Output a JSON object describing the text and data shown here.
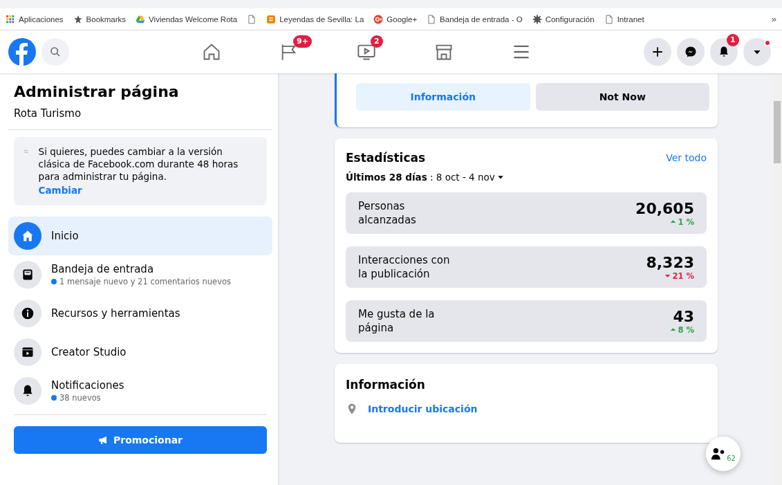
{
  "bookmarks": [
    {
      "label": "Aplicaciones",
      "kind": "apps"
    },
    {
      "label": "Bookmarks",
      "kind": "star"
    },
    {
      "label": "Viviendas Welcome Rota",
      "kind": "drive"
    },
    {
      "kind": "page"
    },
    {
      "label": "Leyendas de Sevilla: La",
      "kind": "blogger"
    },
    {
      "label": "Google+",
      "kind": "gplus"
    },
    {
      "label": "Bandeja de entrada - O",
      "kind": "page"
    },
    {
      "label": "Configuración",
      "kind": "gear"
    },
    {
      "label": "Intranet",
      "kind": "page"
    }
  ],
  "bookmarks_more": "»",
  "nav_tabs": [
    {
      "kind": "home"
    },
    {
      "kind": "flag",
      "badge": "9+"
    },
    {
      "kind": "video",
      "badge": "2"
    },
    {
      "kind": "store"
    },
    {
      "kind": "menu"
    }
  ],
  "nav_actions": [
    {
      "kind": "plus"
    },
    {
      "kind": "messenger"
    },
    {
      "kind": "bell",
      "badge": "1"
    },
    {
      "kind": "caret",
      "dot": true
    }
  ],
  "sidebar": {
    "title": "Administrar página",
    "subtitle": "Rota Turismo",
    "notice": {
      "text": "Si quieres, puedes cambiar a la versión clásica de Facebook.com durante 48 horas para administrar tu página.",
      "link": "Cambiar"
    },
    "items": [
      {
        "kind": "home",
        "label": "Inicio",
        "selected": true
      },
      {
        "kind": "inbox",
        "label": "Bandeja de entrada",
        "sub": "1 mensaje nuevo y 21 comentarios nuevos",
        "selected": false
      },
      {
        "kind": "info",
        "label": "Recursos y herramientas",
        "selected": false
      },
      {
        "kind": "clapper",
        "label": "Creator Studio",
        "selected": false
      },
      {
        "kind": "bell",
        "label": "Notificaciones",
        "sub": "38 nuevos",
        "selected": false
      }
    ],
    "promote": "Promocionar"
  },
  "prompt_card": {
    "buttons": [
      {
        "label": "Información",
        "kind": "primary"
      },
      {
        "label": "Not Now",
        "kind": "secondary"
      }
    ]
  },
  "stats": {
    "title": "Estadísticas",
    "link": "Ver todo",
    "period": "**Últimos 28 días** : 8 oct - 4 nov",
    "metrics": [
      {
        "label": "Personas alcanzadas",
        "value": "20,605",
        "change": "1 %",
        "kind": "up"
      },
      {
        "label": "Interacciones con la publicación",
        "value": "8,323",
        "change": "21 %",
        "kind": "down"
      },
      {
        "label": "Me gusta de la página",
        "value": "43",
        "change": "8 %",
        "kind": "up"
      }
    ]
  },
  "info": {
    "title": "Información",
    "location": "Introducir ubicación"
  },
  "contacts": {
    "count": "62"
  }
}
